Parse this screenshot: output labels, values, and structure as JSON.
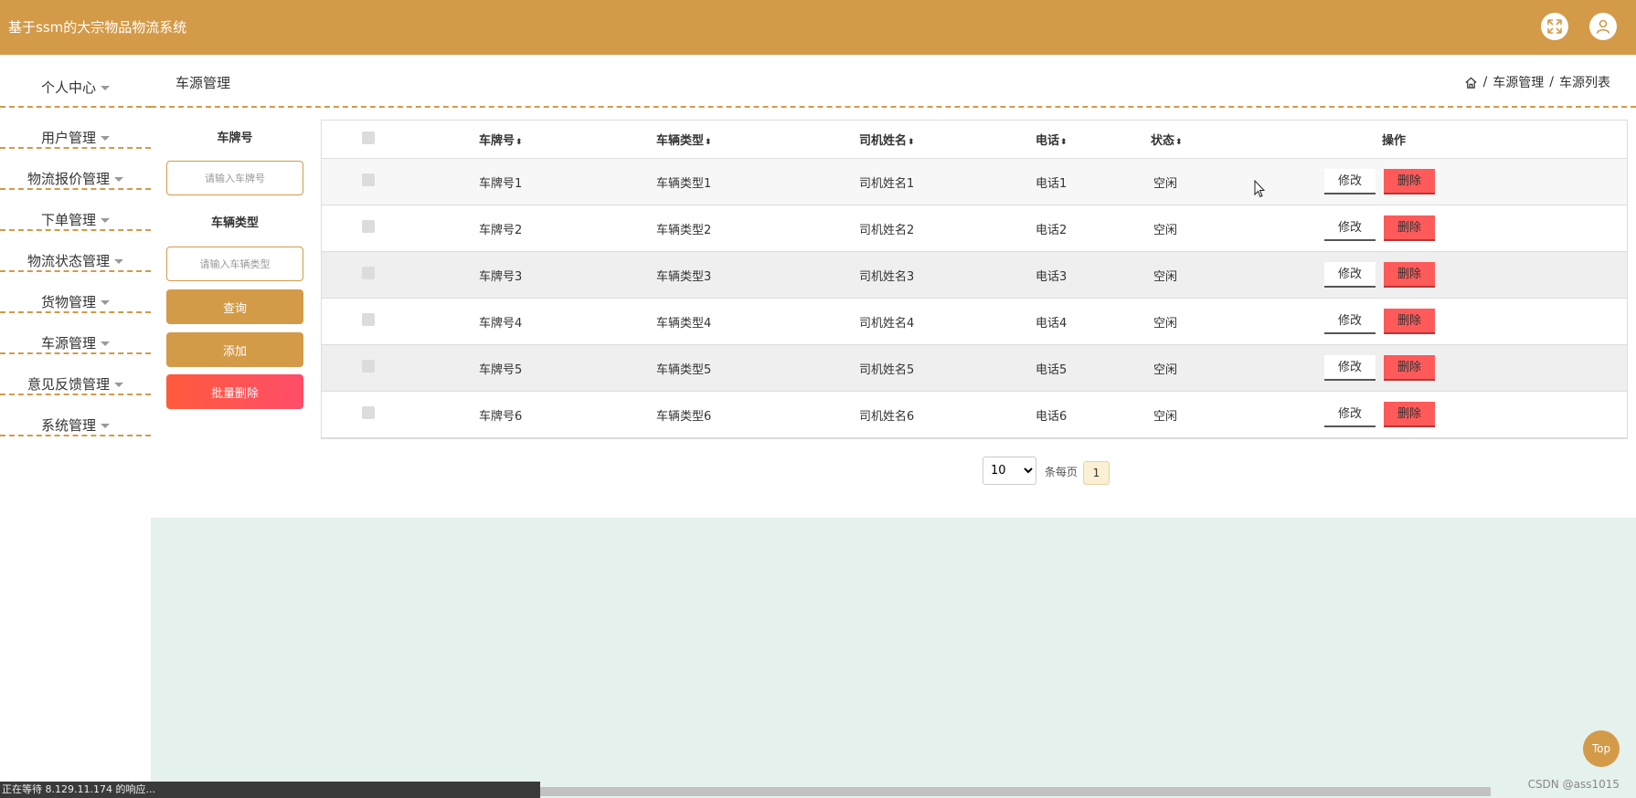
{
  "header": {
    "title": "基于ssm的大宗物品物流系统",
    "fullscreen_icon": "expand-icon",
    "user_icon": "user-icon"
  },
  "sidebar": {
    "items": [
      {
        "label": "个人中心"
      },
      {
        "label": "用户管理"
      },
      {
        "label": "物流报价管理"
      },
      {
        "label": "下单管理"
      },
      {
        "label": "物流状态管理"
      },
      {
        "label": "货物管理"
      },
      {
        "label": "车源管理"
      },
      {
        "label": "意见反馈管理"
      },
      {
        "label": "系统管理"
      }
    ]
  },
  "page": {
    "title": "车源管理",
    "breadcrumb": [
      "车源管理",
      "车源列表"
    ],
    "separator": "/"
  },
  "search": {
    "plate_label": "车牌号",
    "plate_placeholder": "请输入车牌号",
    "type_label": "车辆类型",
    "type_placeholder": "请输入车辆类型",
    "query_button": "查询",
    "add_button": "添加",
    "batch_delete_button": "批量删除"
  },
  "table": {
    "headers": [
      "车牌号",
      "车辆类型",
      "司机姓名",
      "电话",
      "状态",
      "操作"
    ],
    "sort_glyph": "⬍",
    "rows": [
      {
        "plate": "车牌号1",
        "type": "车辆类型1",
        "driver": "司机姓名1",
        "phone": "电话1",
        "status": "空闲",
        "edit": "修改",
        "delete": "删除"
      },
      {
        "plate": "车牌号2",
        "type": "车辆类型2",
        "driver": "司机姓名2",
        "phone": "电话2",
        "status": "空闲",
        "edit": "修改",
        "delete": "删除"
      },
      {
        "plate": "车牌号3",
        "type": "车辆类型3",
        "driver": "司机姓名3",
        "phone": "电话3",
        "status": "空闲",
        "edit": "修改",
        "delete": "删除"
      },
      {
        "plate": "车牌号4",
        "type": "车辆类型4",
        "driver": "司机姓名4",
        "phone": "电话4",
        "status": "空闲",
        "edit": "修改",
        "delete": "删除"
      },
      {
        "plate": "车牌号5",
        "type": "车辆类型5",
        "driver": "司机姓名5",
        "phone": "电话5",
        "status": "空闲",
        "edit": "修改",
        "delete": "删除"
      },
      {
        "plate": "车牌号6",
        "type": "车辆类型6",
        "driver": "司机姓名6",
        "phone": "电话6",
        "status": "空闲",
        "edit": "修改",
        "delete": "删除"
      }
    ]
  },
  "pagination": {
    "page_size": "10",
    "page_size_options": [
      "10"
    ],
    "per_page_label": "条每页",
    "current_page": "1"
  },
  "status_bar": "正在等待 8.129.11.174 的响应...",
  "watermark": "CSDN @ass1015",
  "top_button": "Top",
  "colors": {
    "brand": "#d39a48",
    "danger": "#ff5a5a",
    "footer_bg": "#e5f1ec"
  }
}
